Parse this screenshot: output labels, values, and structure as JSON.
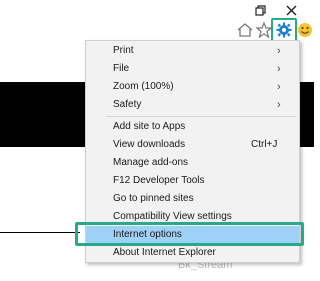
{
  "title_bar": {
    "restore_icon": "restore-icon",
    "close_icon": "close-icon",
    "close_glyph": "✕"
  },
  "toolbar": {
    "home_icon": "home-icon",
    "favorites_icon": "star-icon",
    "tools_icon": "gear-icon",
    "feedback_icon": "smiley-icon",
    "accent_color": "#2aa88a",
    "gear_color": "#1e7fd6"
  },
  "menu": {
    "items": [
      {
        "label": "Print",
        "arrow": "›"
      },
      {
        "label": "File",
        "arrow": "›"
      },
      {
        "label": "Zoom (100%)",
        "arrow": "›"
      },
      {
        "label": "Safety",
        "arrow": "›"
      },
      {
        "label": "Add site to Apps"
      },
      {
        "label": "View downloads",
        "shortcut": "Ctrl+J"
      },
      {
        "label": "Manage add-ons"
      },
      {
        "label": "F12 Developer Tools"
      },
      {
        "label": "Go to pinned sites"
      },
      {
        "label": "Compatibility View settings"
      },
      {
        "label": "Internet options"
      },
      {
        "label": "About Internet Explorer"
      }
    ],
    "highlight_color": "#9fd0f5"
  },
  "page": {
    "faded_text": "Bk_Stream"
  }
}
